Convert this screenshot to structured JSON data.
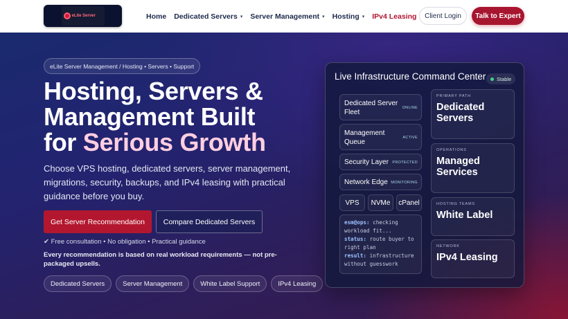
{
  "header": {
    "logo_text": "eLite Server",
    "nav": [
      {
        "label": "Home",
        "has_menu": false
      },
      {
        "label": "Dedicated Servers",
        "has_menu": true
      },
      {
        "label": "Server Management",
        "has_menu": true
      },
      {
        "label": "Hosting",
        "has_menu": true
      },
      {
        "label": "IPv4 Leasing",
        "has_menu": false
      }
    ],
    "client_login": "Client Login",
    "talk_to_expert": "Talk to Expert"
  },
  "hero": {
    "breadcrumb": "eLite Server Management / Hosting • Servers • Support",
    "headline_line1": "Hosting, Servers &",
    "headline_line2": "Management Built",
    "headline_line3_prefix": "for ",
    "headline_line3_accent": "Serious Growth",
    "lede": "Choose VPS hosting, dedicated servers, server management, migrations, security, backups, and IPv4 leasing with practical guidance before you buy.",
    "primary_cta": "Get Server Recommendation",
    "secondary_cta": "Compare Dedicated Servers",
    "checks": "✔ Free consultation • No obligation • Practical guidance",
    "note": "Every recommendation is based on real workload requirements — not pre-packaged upsells.",
    "pills": [
      "Dedicated Servers",
      "Server Management",
      "White Label Support",
      "IPv4 Leasing"
    ]
  },
  "panel": {
    "title": "Live Infrastructure Command Center",
    "status": "Stable",
    "status_color": "#3fd48a",
    "cards": [
      {
        "label": "Dedicated Server Fleet",
        "status": "ONLINE"
      },
      {
        "label": "Management Queue",
        "status": "ACTIVE"
      },
      {
        "label": "Security Layer",
        "status": "PROTECTED"
      },
      {
        "label": "Network Edge",
        "status": "MONITORING"
      }
    ],
    "chips": [
      "VPS",
      "NVMe",
      "cPanel"
    ],
    "terminal": [
      {
        "key": "esm@ops:",
        "text": " checking workload fit..."
      },
      {
        "key": "status:",
        "text": " route buyer to right plan"
      },
      {
        "key": "result:",
        "text": " infrastructure without guesswork"
      }
    ],
    "right_cards": [
      {
        "kicker": "PRIMARY PATH",
        "value": "Dedicated Servers"
      },
      {
        "kicker": "OPERATIONS",
        "value": "Managed Services"
      },
      {
        "kicker": "HOSTING TEAMS",
        "value": "White Label"
      },
      {
        "kicker": "NETWORK",
        "value": "IPv4 Leasing"
      }
    ]
  },
  "colors": {
    "brand_red": "#a8152f",
    "hero_navy": "#1a2a6e",
    "accent_pink": "#ffcfe0"
  }
}
